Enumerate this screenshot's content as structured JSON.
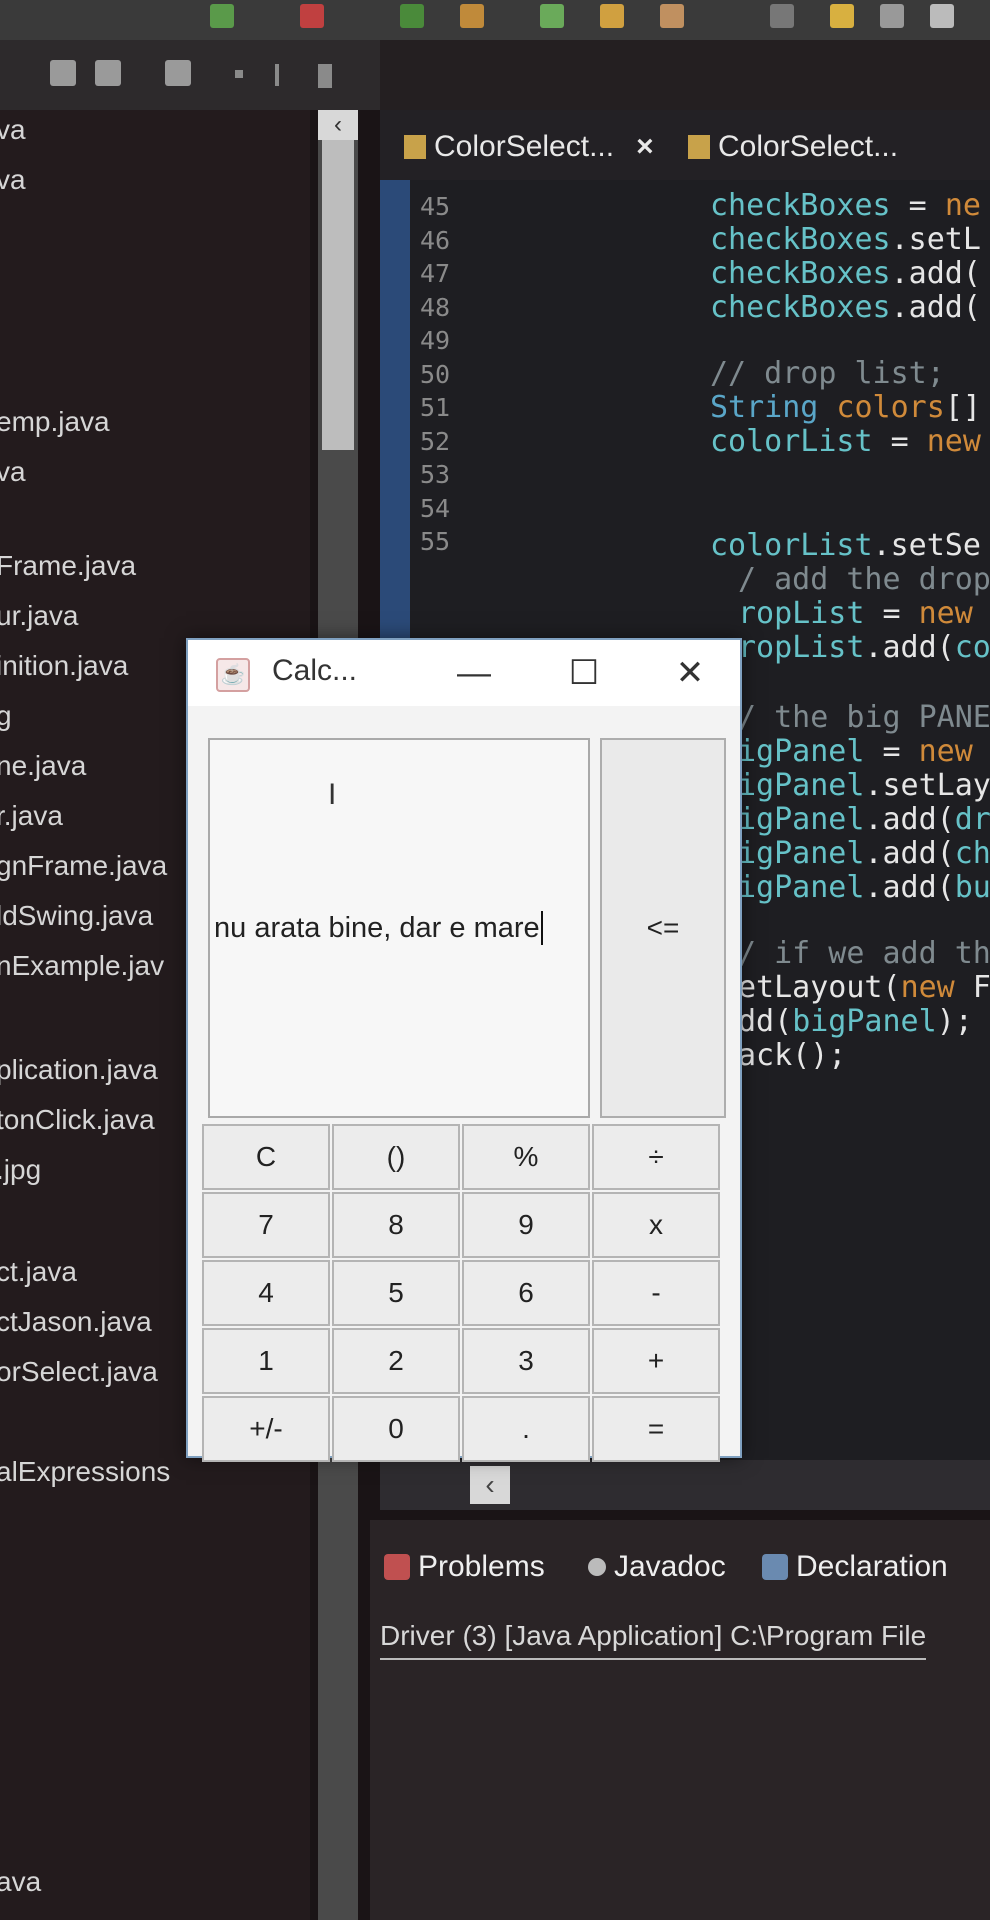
{
  "explorer": {
    "items": [
      {
        "label": "va"
      },
      {
        "label": "va"
      },
      {
        "label": "emp.java"
      },
      {
        "label": "va"
      },
      {
        "label": "Frame.java"
      },
      {
        "label": "ur.java"
      },
      {
        "label": "inition.java"
      },
      {
        "label": "g"
      },
      {
        "label": "ne.java"
      },
      {
        "label": "r.java"
      },
      {
        "label": "gnFrame.java"
      },
      {
        "label": "ldSwing.java"
      },
      {
        "label": "nExample.jav"
      },
      {
        "label": "plication.java"
      },
      {
        "label": "tonClick.java"
      },
      {
        "label": ".jpg"
      },
      {
        "label": "ct.java"
      },
      {
        "label": "ctJason.java"
      },
      {
        "label": "orSelect.java"
      },
      {
        "label": "alExpressions"
      },
      {
        "label": "ava"
      }
    ]
  },
  "editor": {
    "tabs": [
      {
        "label": "ColorSelect...",
        "close": "×"
      },
      {
        "label": "ColorSelect..."
      }
    ],
    "line_numbers": [
      "45",
      "46",
      "47",
      "48",
      "49",
      "50",
      "51",
      "52",
      "53",
      "54",
      "55"
    ],
    "code_lines": [
      {
        "tokens": [
          {
            "t": "checkBoxes",
            "c": "c-field"
          },
          {
            "t": " = ",
            "c": "c-plain"
          },
          {
            "t": "ne",
            "c": "c-kw"
          }
        ]
      },
      {
        "tokens": [
          {
            "t": "checkBoxes",
            "c": "c-field"
          },
          {
            "t": ".setL",
            "c": "c-plain"
          }
        ]
      },
      {
        "tokens": [
          {
            "t": "checkBoxes",
            "c": "c-field"
          },
          {
            "t": ".add(",
            "c": "c-plain"
          }
        ]
      },
      {
        "tokens": [
          {
            "t": "checkBoxes",
            "c": "c-field"
          },
          {
            "t": ".add(",
            "c": "c-plain"
          }
        ]
      },
      {
        "tokens": [
          {
            "t": "// drop list;",
            "c": "c-cmt"
          }
        ]
      },
      {
        "tokens": [
          {
            "t": "String",
            "c": "c-type"
          },
          {
            "t": " colors",
            "c": "c-kw"
          },
          {
            "t": "[]",
            "c": "c-plain"
          }
        ]
      },
      {
        "tokens": [
          {
            "t": "colorList",
            "c": "c-field"
          },
          {
            "t": " = ",
            "c": "c-plain"
          },
          {
            "t": "new",
            "c": "c-kw"
          }
        ]
      },
      {
        "tokens": [
          {
            "t": "colorList",
            "c": "c-field"
          },
          {
            "t": ".setSe",
            "c": "c-plain"
          }
        ]
      },
      {
        "tokens": [
          {
            "t": "/ add the drop",
            "c": "c-cmt"
          }
        ]
      },
      {
        "tokens": [
          {
            "t": "ropList",
            "c": "c-field"
          },
          {
            "t": " = ",
            "c": "c-plain"
          },
          {
            "t": "new",
            "c": "c-kw"
          }
        ]
      },
      {
        "tokens": [
          {
            "t": "ropList",
            "c": "c-field"
          },
          {
            "t": ".add(",
            "c": "c-plain"
          },
          {
            "t": "co",
            "c": "c-field"
          }
        ]
      },
      {
        "tokens": [
          {
            "t": "/ the big PANE",
            "c": "c-cmt"
          }
        ]
      },
      {
        "tokens": [
          {
            "t": "igPanel",
            "c": "c-field"
          },
          {
            "t": " = ",
            "c": "c-plain"
          },
          {
            "t": "new",
            "c": "c-kw"
          }
        ]
      },
      {
        "tokens": [
          {
            "t": "igPanel",
            "c": "c-field"
          },
          {
            "t": ".setLay",
            "c": "c-plain"
          }
        ]
      },
      {
        "tokens": [
          {
            "t": "igPanel",
            "c": "c-field"
          },
          {
            "t": ".add(",
            "c": "c-plain"
          },
          {
            "t": "dr",
            "c": "c-field"
          }
        ]
      },
      {
        "tokens": [
          {
            "t": "igPanel",
            "c": "c-field"
          },
          {
            "t": ".add(",
            "c": "c-plain"
          },
          {
            "t": "ch",
            "c": "c-field"
          }
        ]
      },
      {
        "tokens": [
          {
            "t": "igPanel",
            "c": "c-field"
          },
          {
            "t": ".add(",
            "c": "c-plain"
          },
          {
            "t": "bu",
            "c": "c-field"
          }
        ]
      },
      {
        "tokens": [
          {
            "t": "/ if we add th",
            "c": "c-cmt"
          }
        ]
      },
      {
        "tokens": [
          {
            "t": "etLayout(",
            "c": "c-plain"
          },
          {
            "t": "new",
            "c": "c-kw"
          },
          {
            "t": " F",
            "c": "c-plain"
          }
        ]
      },
      {
        "tokens": [
          {
            "t": "dd(",
            "c": "c-plain"
          },
          {
            "t": "bigPanel",
            "c": "c-field"
          },
          {
            "t": ");",
            "c": "c-plain"
          }
        ]
      },
      {
        "tokens": [
          {
            "t": "ack();",
            "c": "c-plain"
          }
        ]
      }
    ]
  },
  "bottom_panel": {
    "tabs": [
      {
        "label": "Problems"
      },
      {
        "label": "Javadoc"
      },
      {
        "label": "Declaration"
      }
    ],
    "console_line": "Driver (3) [Java Application] C:\\Program File"
  },
  "calculator": {
    "title": "Calc...",
    "minimize": "—",
    "maximize": "☐",
    "close": "✕",
    "display_text": "nu arata bine, dar e mare",
    "backspace_label": "<=",
    "keys": [
      [
        "C",
        "()",
        "%",
        "÷"
      ],
      [
        "7",
        "8",
        "9",
        "x"
      ],
      [
        "4",
        "5",
        "6",
        "-"
      ],
      [
        "1",
        "2",
        "3",
        "+"
      ],
      [
        "+/-",
        "0",
        ".",
        "="
      ]
    ]
  }
}
